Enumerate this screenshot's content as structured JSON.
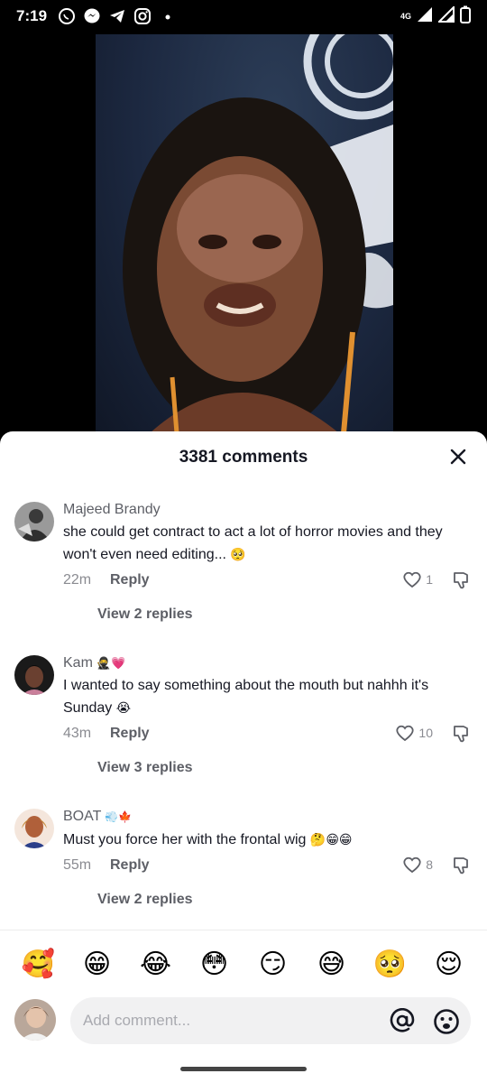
{
  "status_bar": {
    "time": "7:19",
    "network": "4G",
    "left_icons": [
      "whatsapp-icon",
      "messenger-icon",
      "telegram-icon",
      "instagram-icon",
      "dot-icon"
    ],
    "right_icons": [
      "signal-icon",
      "signal-icon",
      "battery-icon"
    ]
  },
  "comments_sheet": {
    "title": "3381 comments",
    "comments": [
      {
        "username": "Majeed Brandy",
        "text": "she could get contract to act a lot of horror movies and they won't even need editing...",
        "text_emoji": "🥺",
        "time": "22m",
        "reply_label": "Reply",
        "likes": "1",
        "view_replies": "View 2 replies"
      },
      {
        "username": "Kam",
        "username_emoji": "🥷💗",
        "text": "I wanted to say something about the mouth but nahhh it's Sunday",
        "text_emoji": "😭",
        "time": "43m",
        "reply_label": "Reply",
        "likes": "10",
        "view_replies": "View 3 replies"
      },
      {
        "username": "BOAT",
        "username_emoji": "💨🍁",
        "text": "Must you force her with the frontal wig",
        "text_emoji": "🤔😁😁",
        "time": "55m",
        "reply_label": "Reply",
        "likes": "8",
        "view_replies": "View 2 replies"
      }
    ],
    "emoji_bar": [
      "🥰",
      "😁",
      "😂",
      "😳",
      "😏",
      "😅",
      "🥺",
      "😌"
    ],
    "input": {
      "placeholder": "Add comment..."
    }
  },
  "colors": {
    "accent_text": "#161823",
    "secondary_text": "#5d5f66",
    "muted_text": "#8a8b91",
    "sheet_background": "#ffffff"
  }
}
